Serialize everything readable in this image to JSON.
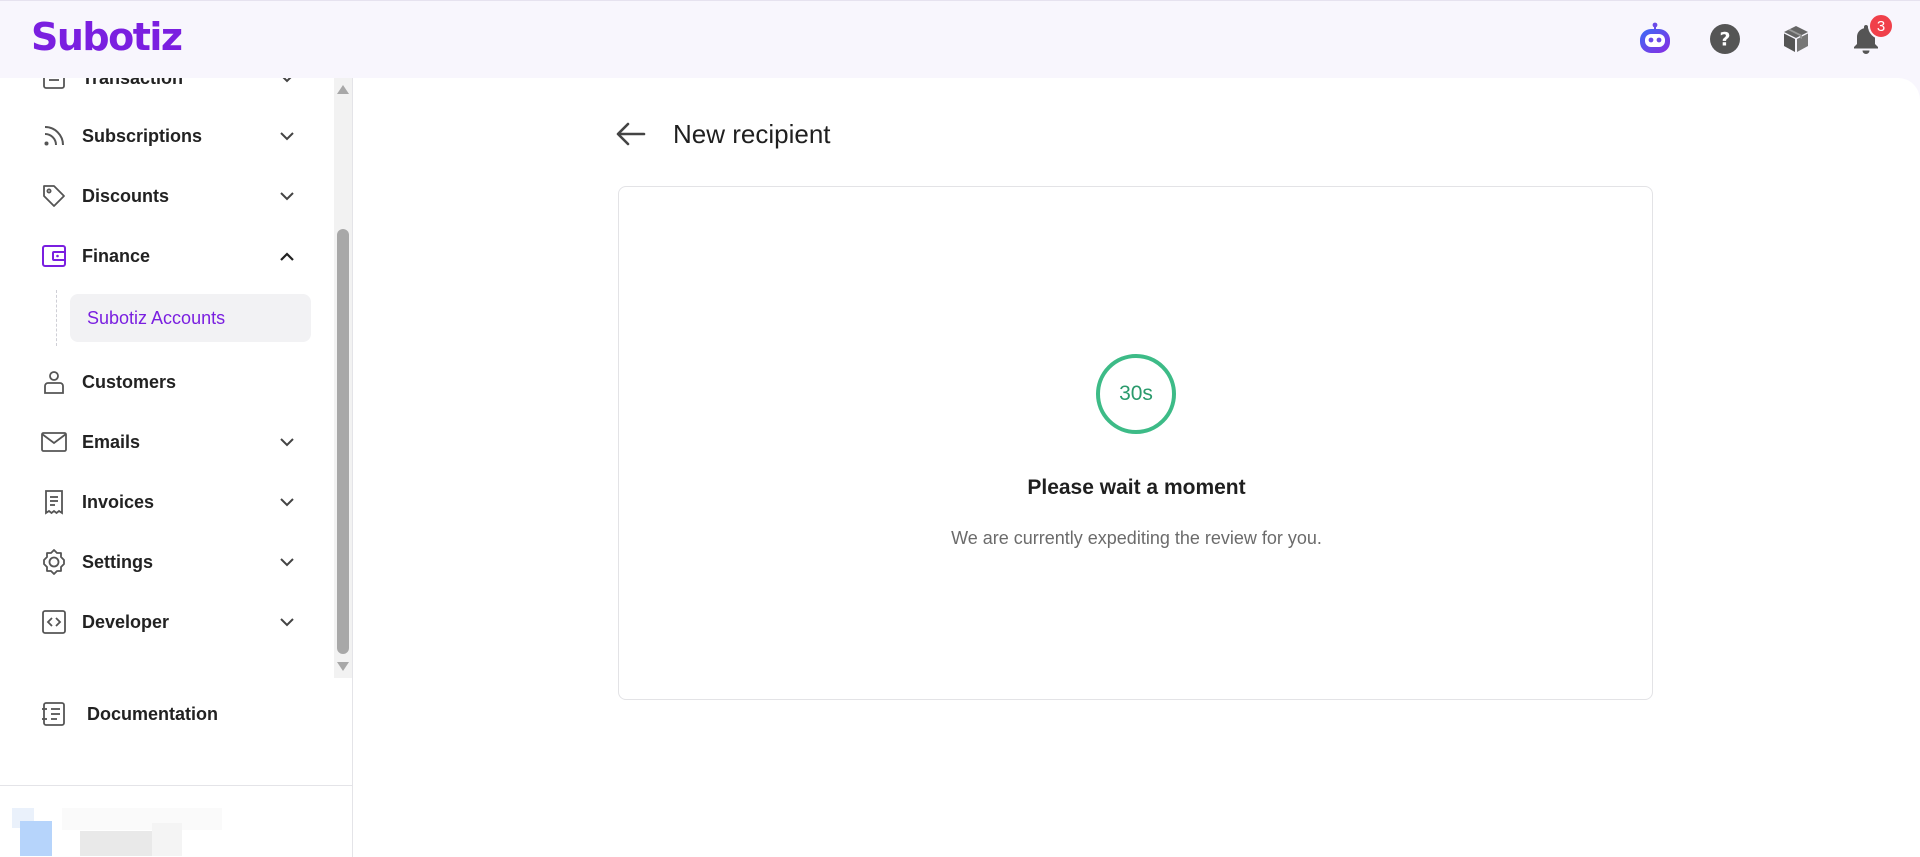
{
  "brand": {
    "name": "Subotiz",
    "color": "#7a1fe0"
  },
  "topbar": {
    "icons": [
      "assistant-bot-icon",
      "help-icon",
      "package-icon",
      "bell-icon"
    ],
    "notification_count": "3"
  },
  "sidebar": {
    "items": [
      {
        "label": "Transaction",
        "icon": "transaction-icon",
        "chevron": "down"
      },
      {
        "label": "Subscriptions",
        "icon": "rss-icon",
        "chevron": "down"
      },
      {
        "label": "Discounts",
        "icon": "tag-icon",
        "chevron": "down"
      },
      {
        "label": "Finance",
        "icon": "wallet-icon",
        "chevron": "up",
        "active": true
      },
      {
        "label": "Customers",
        "icon": "user-icon"
      },
      {
        "label": "Emails",
        "icon": "mail-icon",
        "chevron": "down"
      },
      {
        "label": "Invoices",
        "icon": "receipt-icon",
        "chevron": "down"
      },
      {
        "label": "Settings",
        "icon": "gear-icon",
        "chevron": "down"
      },
      {
        "label": "Developer",
        "icon": "code-icon",
        "chevron": "down"
      }
    ],
    "finance_sub": {
      "label": "Subotiz Accounts"
    },
    "documentation": {
      "label": "Documentation",
      "icon": "docs-icon"
    }
  },
  "main": {
    "title": "New recipient",
    "countdown": "30s",
    "wait_title": "Please wait a moment",
    "wait_desc": "We are currently expediting the review for you.",
    "accent_green": "#3dbb87"
  }
}
